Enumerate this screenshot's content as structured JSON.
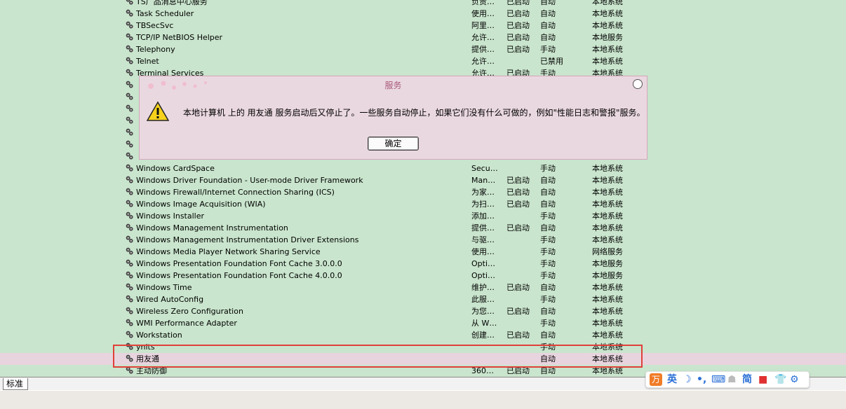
{
  "services": [
    {
      "name": "TS厂品消息中心服务",
      "desc": "负责…",
      "status": "已启动",
      "startup": "自动",
      "logon": "本地系统"
    },
    {
      "name": "Task Scheduler",
      "desc": "使用…",
      "status": "已启动",
      "startup": "自动",
      "logon": "本地系统"
    },
    {
      "name": "TBSecSvc",
      "desc": "阿里…",
      "status": "已启动",
      "startup": "自动",
      "logon": "本地系统"
    },
    {
      "name": "TCP/IP NetBIOS Helper",
      "desc": "允许…",
      "status": "已启动",
      "startup": "自动",
      "logon": "本地服务"
    },
    {
      "name": "Telephony",
      "desc": "提供…",
      "status": "已启动",
      "startup": "手动",
      "logon": "本地系统"
    },
    {
      "name": "Telnet",
      "desc": "允许…",
      "status": "",
      "startup": "已禁用",
      "logon": "本地系统"
    },
    {
      "name": "Terminal Services",
      "desc": "允许…",
      "status": "已启动",
      "startup": "手动",
      "logon": "本地系统"
    },
    {
      "name": "",
      "desc": "",
      "status": "",
      "startup": "",
      "logon": ""
    },
    {
      "name": "",
      "desc": "",
      "status": "",
      "startup": "",
      "logon": ""
    },
    {
      "name": "",
      "desc": "",
      "status": "",
      "startup": "",
      "logon": ""
    },
    {
      "name": "",
      "desc": "",
      "status": "",
      "startup": "",
      "logon": ""
    },
    {
      "name": "",
      "desc": "",
      "status": "",
      "startup": "",
      "logon": ""
    },
    {
      "name": "",
      "desc": "",
      "status": "",
      "startup": "",
      "logon": ""
    },
    {
      "name": "",
      "desc": "",
      "status": "",
      "startup": "",
      "logon": ""
    },
    {
      "name": "Windows CardSpace",
      "desc": "Secu…",
      "status": "",
      "startup": "手动",
      "logon": "本地系统"
    },
    {
      "name": "Windows Driver Foundation - User-mode Driver Framework",
      "desc": "Man…",
      "status": "已启动",
      "startup": "自动",
      "logon": "本地系统"
    },
    {
      "name": "Windows Firewall/Internet Connection Sharing (ICS)",
      "desc": "为家…",
      "status": "已启动",
      "startup": "自动",
      "logon": "本地系统"
    },
    {
      "name": "Windows Image Acquisition (WIA)",
      "desc": "为扫…",
      "status": "已启动",
      "startup": "自动",
      "logon": "本地系统"
    },
    {
      "name": "Windows Installer",
      "desc": "添加…",
      "status": "",
      "startup": "手动",
      "logon": "本地系统"
    },
    {
      "name": "Windows Management Instrumentation",
      "desc": "提供…",
      "status": "已启动",
      "startup": "自动",
      "logon": "本地系统"
    },
    {
      "name": "Windows Management Instrumentation Driver Extensions",
      "desc": "与驱…",
      "status": "",
      "startup": "手动",
      "logon": "本地系统"
    },
    {
      "name": "Windows Media Player Network Sharing Service",
      "desc": "使用…",
      "status": "",
      "startup": "手动",
      "logon": "网络服务"
    },
    {
      "name": "Windows Presentation Foundation Font Cache 3.0.0.0",
      "desc": "Opti…",
      "status": "",
      "startup": "手动",
      "logon": "本地服务"
    },
    {
      "name": "Windows Presentation Foundation Font Cache 4.0.0.0",
      "desc": "Opti…",
      "status": "",
      "startup": "手动",
      "logon": "本地服务"
    },
    {
      "name": "Windows Time",
      "desc": "维护…",
      "status": "已启动",
      "startup": "自动",
      "logon": "本地系统"
    },
    {
      "name": "Wired AutoConfig",
      "desc": "此服…",
      "status": "",
      "startup": "手动",
      "logon": "本地系统"
    },
    {
      "name": "Wireless Zero Configuration",
      "desc": "为您…",
      "status": "已启动",
      "startup": "自动",
      "logon": "本地系统"
    },
    {
      "name": "WMI Performance Adapter",
      "desc": "从 W…",
      "status": "",
      "startup": "手动",
      "logon": "本地系统"
    },
    {
      "name": "Workstation",
      "desc": "创建…",
      "status": "已启动",
      "startup": "自动",
      "logon": "本地系统"
    },
    {
      "name": "ynits",
      "desc": "",
      "status": "",
      "startup": "手动",
      "logon": "本地系统"
    },
    {
      "name": "用友通",
      "desc": "",
      "status": "",
      "startup": "自动",
      "logon": "本地系统"
    },
    {
      "name": "主动防御",
      "desc": "360…",
      "status": "已启动",
      "startup": "自动",
      "logon": "本地系统"
    }
  ],
  "selected_index": 30,
  "dialog": {
    "title": "服务",
    "message": "本地计算机 上的 用友通 服务启动后又停止了。一些服务自动停止，如果它们没有什么可做的，例如\"性能日志和警报\"服务。",
    "ok_label": "确定"
  },
  "tab": {
    "label": "标准"
  },
  "ime": {
    "logo": "万",
    "lang": "英",
    "moon": "☽",
    "punct": "•,",
    "keyboard": "⌨",
    "user": "☗",
    "simp": "简",
    "cam": "■",
    "shirt": "👕",
    "gear": "⚙"
  },
  "colors": {
    "background": "#c9e5cd",
    "highlight": "#e0403a",
    "dialog_bg": "#ead8e0"
  }
}
